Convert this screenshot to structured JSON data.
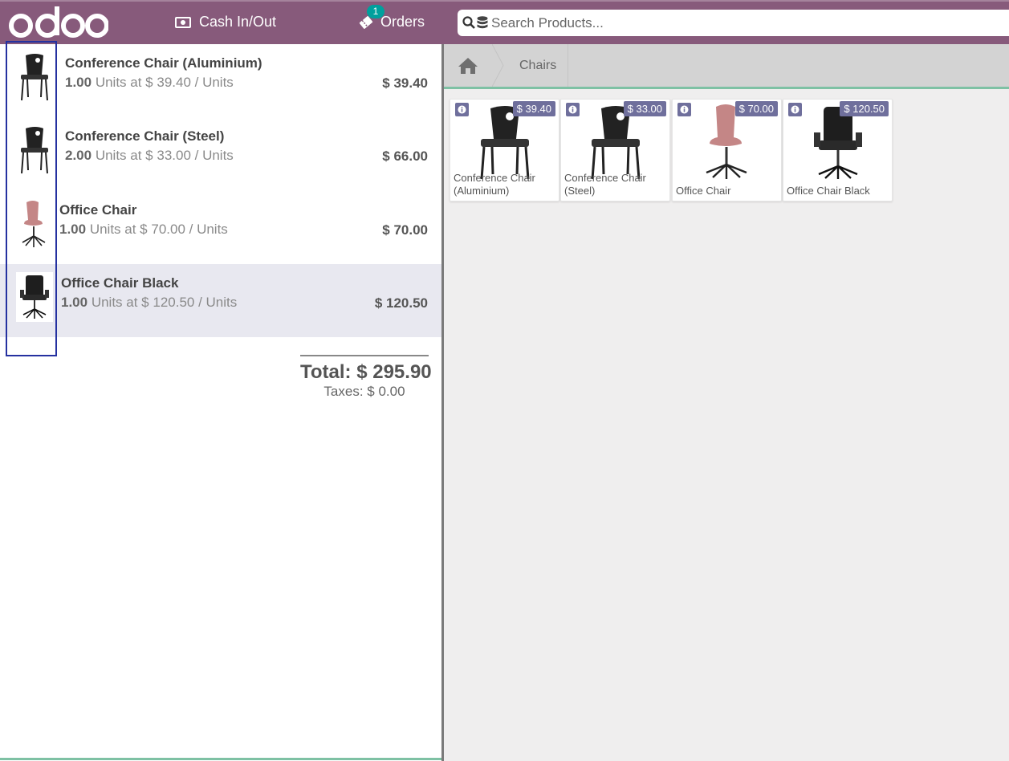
{
  "header": {
    "logo_text": "odoo",
    "cash_label": "Cash In/Out",
    "orders_label": "Orders",
    "orders_badge": "1",
    "search_placeholder": "Search Products..."
  },
  "order": {
    "lines": [
      {
        "name": "Conference Chair (Aluminium)",
        "qty": "1.00",
        "detail": "Units at $ 39.40 / Units",
        "price": "$ 39.40",
        "image": "black-stacking-chair-icon"
      },
      {
        "name": "Conference Chair (Steel)",
        "qty": "2.00",
        "detail": "Units at $ 33.00 / Units",
        "price": "$ 66.00",
        "image": "black-stacking-chair-icon"
      },
      {
        "name": "Office Chair",
        "qty": "1.00",
        "detail": "Units at $ 70.00 / Units",
        "price": "$ 70.00",
        "image": "pink-swivel-chair-icon"
      },
      {
        "name": "Office Chair Black",
        "qty": "1.00",
        "detail": "Units at $ 120.50 / Units",
        "price": "$ 120.50",
        "image": "black-executive-chair-icon",
        "selected": true
      }
    ],
    "total_label": "Total:",
    "total_value": "$ 295.90",
    "taxes_label": "Taxes:",
    "taxes_value": "$ 0.00"
  },
  "breadcrumb": {
    "home_icon": "home-icon",
    "category": "Chairs"
  },
  "products": [
    {
      "name": "Conference Chair (Aluminium)",
      "price": "$ 39.40",
      "image": "black-stacking-chair-icon"
    },
    {
      "name": "Conference Chair (Steel)",
      "price": "$ 33.00",
      "image": "black-stacking-chair-icon"
    },
    {
      "name": "Office Chair",
      "price": "$ 70.00",
      "image": "pink-swivel-chair-icon"
    },
    {
      "name": "Office Chair Black",
      "price": "$ 120.50",
      "image": "black-executive-chair-icon"
    }
  ],
  "colors": {
    "brand": "#875a7b",
    "accent": "#00a09d",
    "tag": "#6f6f9c",
    "selected_line": "#e8e8f0"
  }
}
